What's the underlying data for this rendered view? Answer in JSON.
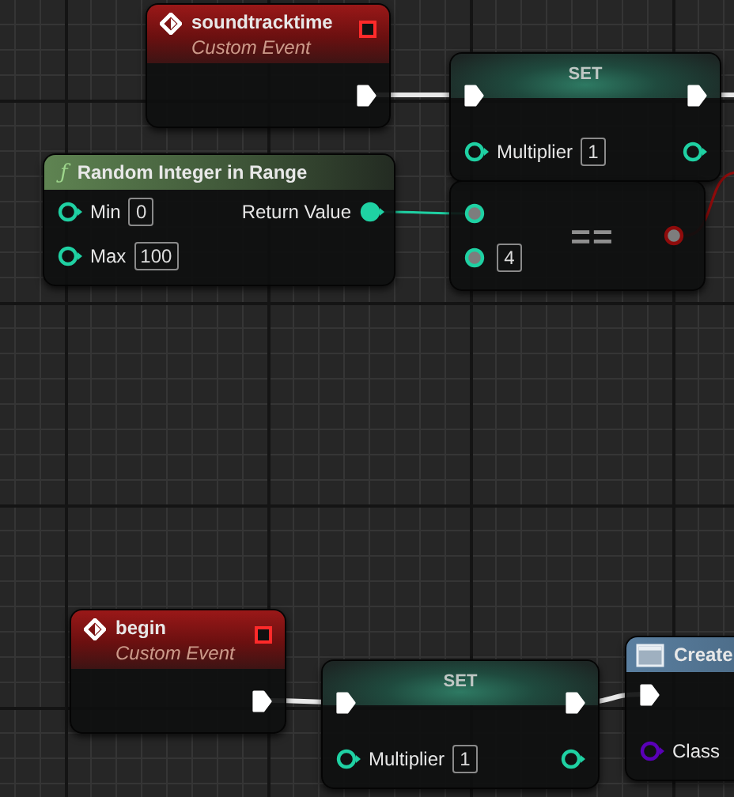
{
  "nodes": [
    {
      "kind": "event",
      "title": "soundtracktime",
      "subtitle": "Custom Event",
      "outputs": [
        {
          "kind": "exec",
          "filled": true
        }
      ]
    },
    {
      "kind": "set",
      "title": "SET",
      "inputs": [
        {
          "kind": "exec",
          "filled": true
        },
        {
          "kind": "int",
          "label": "Multiplier",
          "value": "1",
          "filled": false
        }
      ],
      "outputs": [
        {
          "kind": "exec",
          "filled": true
        },
        {
          "kind": "int",
          "filled": false
        }
      ]
    },
    {
      "kind": "function",
      "glyph": "ƒ",
      "title": "Random Integer in Range",
      "inputs": [
        {
          "kind": "int",
          "label": "Min",
          "value": "0",
          "filled": false
        },
        {
          "kind": "int",
          "label": "Max",
          "value": "100",
          "filled": false
        }
      ],
      "outputs": [
        {
          "kind": "int",
          "label": "Return Value",
          "filled": true
        }
      ]
    },
    {
      "kind": "operator",
      "title": "==",
      "inputs": [
        {
          "kind": "wildcard",
          "filled": true
        },
        {
          "kind": "wildcard",
          "value": "4",
          "filled": true
        }
      ],
      "outputs": [
        {
          "kind": "bool",
          "filled": true
        }
      ]
    },
    {
      "kind": "event",
      "title": "begin",
      "subtitle": "Custom Event",
      "outputs": [
        {
          "kind": "exec",
          "filled": true
        }
      ]
    },
    {
      "kind": "set",
      "title": "SET",
      "inputs": [
        {
          "kind": "exec",
          "filled": true
        },
        {
          "kind": "int",
          "label": "Multiplier",
          "value": "1",
          "filled": false
        }
      ],
      "outputs": [
        {
          "kind": "exec",
          "filled": true
        },
        {
          "kind": "int",
          "filled": false
        }
      ]
    },
    {
      "kind": "create",
      "title": "Create",
      "inputs": [
        {
          "kind": "exec",
          "filled": true
        },
        {
          "kind": "class",
          "label": "Class",
          "filled": false
        }
      ]
    }
  ]
}
